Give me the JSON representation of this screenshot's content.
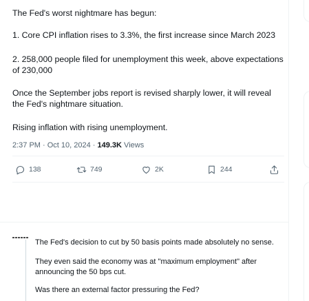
{
  "tweet": {
    "paragraphs": [
      "The Fed's worst nightmare has begun:",
      "1. Core CPI inflation rises to 3.3%, the first increase since March 2023",
      "2. 258,000 people filed for unemployment this week, above expectations of 230,000",
      "Once the September jobs report is revised sharply lower, it will reveal the Fed's nightmare situation.",
      "Rising inflation with rising unemployment."
    ],
    "timestamp": "2:37 PM · Oct 10, 2024 · ",
    "views_count": "149.3K",
    "views_label": " Views"
  },
  "actions": {
    "replies": "138",
    "reposts": "749",
    "likes": "2K",
    "bookmarks": "244"
  },
  "reply": {
    "paragraphs": [
      "The Fed's decision to cut by 50 basis points made absolutely no sense.",
      "They even said the economy was at \"maximum employment\" after announcing the 50 bps cut.",
      "Was there an external factor pressuring the Fed?"
    ]
  },
  "icons": {
    "reply": "speech-bubble-icon",
    "repost": "repost-arrows-icon",
    "like": "heart-icon",
    "bookmark": "bookmark-icon",
    "share": "share-upload-icon"
  },
  "colors": {
    "text": "#0f1419",
    "secondary": "#536471",
    "border": "#eff3f4"
  }
}
